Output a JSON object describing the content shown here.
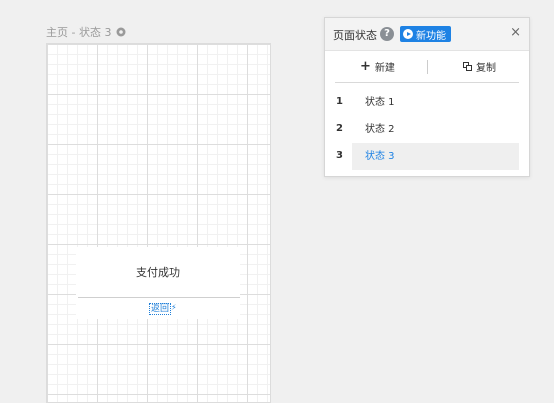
{
  "breadcrumb": {
    "text": "主页 - 状态 3"
  },
  "canvas": {
    "card_title": "支付成功",
    "back_link": "返回"
  },
  "panel": {
    "title": "页面状态",
    "help": "?",
    "badge": "新功能",
    "close": "×",
    "new_label": "新建",
    "copy_label": "复制",
    "states": [
      {
        "num": "1",
        "label": "状态 1",
        "active": false
      },
      {
        "num": "2",
        "label": "状态 2",
        "active": false
      },
      {
        "num": "3",
        "label": "状态 3",
        "active": true
      }
    ]
  },
  "colors": {
    "accent": "#1e82e4",
    "link": "#1f7fd8",
    "selected_bg": "#efefef"
  }
}
